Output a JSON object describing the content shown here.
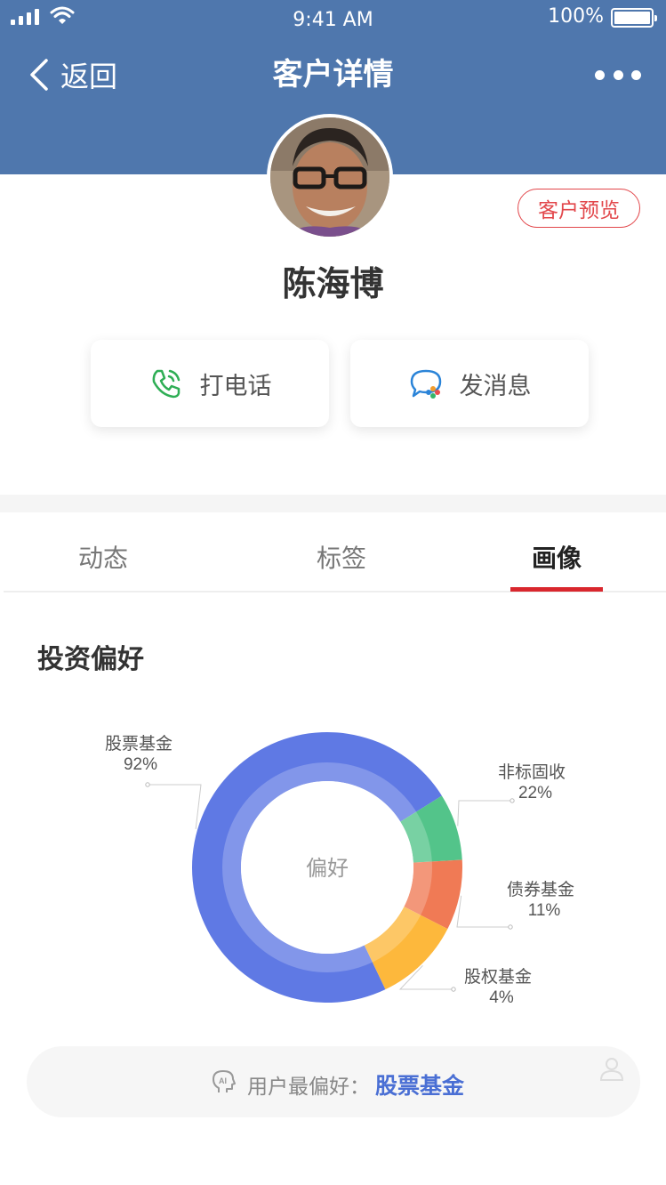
{
  "status_bar": {
    "time": "9:41 AM",
    "battery": "100%"
  },
  "nav": {
    "back_label": "返回",
    "title": "客户详情"
  },
  "profile": {
    "name": "陈海博",
    "preview_label": "客户预览"
  },
  "actions": {
    "call_label": "打电话",
    "message_label": "发消息"
  },
  "tabs": [
    {
      "label": "动态",
      "active": false
    },
    {
      "label": "标签",
      "active": false
    },
    {
      "label": "画像",
      "active": true
    }
  ],
  "section": {
    "title": "投资偏好"
  },
  "chart_data": {
    "type": "pie",
    "center_label": "偏好",
    "series": [
      {
        "name": "股票基金",
        "label": "92%",
        "value": 0.732,
        "color": "#5f79e4"
      },
      {
        "name": "非标固收",
        "label": "22%",
        "value": 0.08,
        "color": "#53c48a"
      },
      {
        "name": "债券基金",
        "label": "11%",
        "value": 0.084,
        "color": "#f07a55"
      },
      {
        "name": "股权基金",
        "label": "4%",
        "value": 0.104,
        "color": "#fdb83c"
      }
    ]
  },
  "summary": {
    "label": "用户最偏好：",
    "value": "股票基金"
  },
  "colors": {
    "header": "#4f77ad",
    "accent_red": "#d9272e",
    "link_blue": "#4a6fd4"
  }
}
